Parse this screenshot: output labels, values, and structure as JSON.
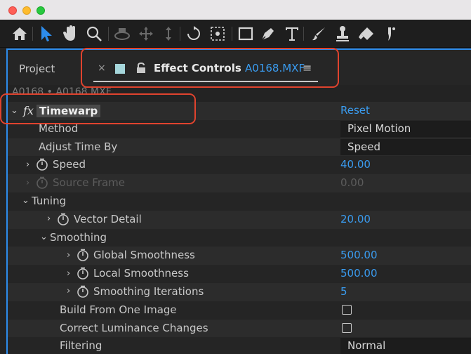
{
  "window": {
    "title": ""
  },
  "toolbar": {
    "tools": [
      {
        "name": "home-icon",
        "state": "normal"
      },
      {
        "name": "selection-tool-icon",
        "state": "active"
      },
      {
        "name": "hand-tool-icon",
        "state": "normal"
      },
      {
        "name": "zoom-tool-icon",
        "state": "normal"
      },
      {
        "name": "orbit-camera-icon",
        "state": "dim"
      },
      {
        "name": "pan-camera-icon",
        "state": "dim"
      },
      {
        "name": "dolly-camera-icon",
        "state": "dim"
      },
      {
        "name": "rotation-tool-icon",
        "state": "normal"
      },
      {
        "name": "pan-behind-icon",
        "state": "normal"
      },
      {
        "name": "rectangle-tool-icon",
        "state": "normal"
      },
      {
        "name": "pen-tool-icon",
        "state": "normal"
      },
      {
        "name": "type-tool-icon",
        "state": "normal"
      },
      {
        "name": "brush-tool-icon",
        "state": "normal"
      },
      {
        "name": "clone-stamp-icon",
        "state": "normal"
      },
      {
        "name": "eraser-tool-icon",
        "state": "normal"
      },
      {
        "name": "roto-brush-icon",
        "state": "normal"
      }
    ],
    "colors": {
      "active": "#2d8ceb"
    }
  },
  "tabs": {
    "project": "Project",
    "close": "×",
    "effect_controls_label": "Effect Controls",
    "effect_controls_file": "A0168.MXF",
    "menu": "≡"
  },
  "comp_line": "A0168 • A0168.MXF",
  "effect": {
    "fx": "fx",
    "name": "Timewarp",
    "reset": "Reset"
  },
  "properties": {
    "method": {
      "label": "Method",
      "value": "Pixel Motion"
    },
    "adjust_time_by": {
      "label": "Adjust Time By",
      "value": "Speed"
    },
    "speed": {
      "label": "Speed",
      "value": "40.00"
    },
    "source_frame": {
      "label": "Source Frame",
      "value": "0.00"
    },
    "tuning": {
      "label": "Tuning"
    },
    "vector_detail": {
      "label": "Vector Detail",
      "value": "20.00"
    },
    "smoothing": {
      "label": "Smoothing"
    },
    "global_smoothness": {
      "label": "Global Smoothness",
      "value": "500.00"
    },
    "local_smoothness": {
      "label": "Local Smoothness",
      "value": "500.00"
    },
    "smoothing_iterations": {
      "label": "Smoothing Iterations",
      "value": "5"
    },
    "build_from_one_image": {
      "label": "Build From One Image",
      "checked": false
    },
    "correct_luminance": {
      "label": "Correct Luminance Changes",
      "checked": false
    },
    "filtering": {
      "label": "Filtering",
      "value": "Normal"
    }
  },
  "colors": {
    "accent_blue": "#3a9cf0",
    "annotation_red": "#e0432e",
    "panel_bg": "#232323"
  }
}
